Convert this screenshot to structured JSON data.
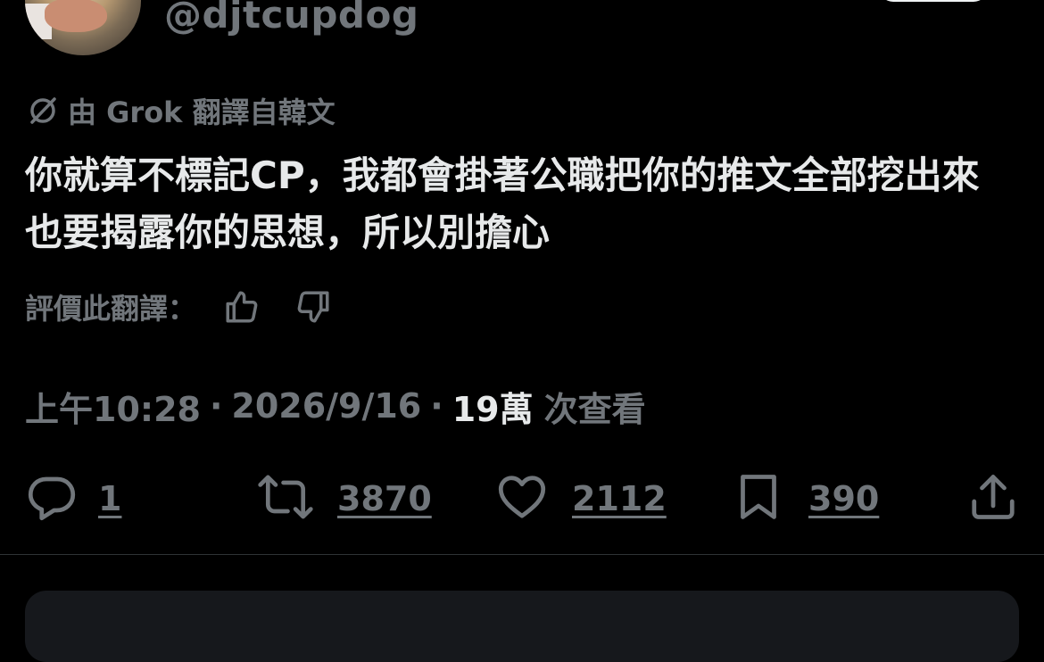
{
  "tweet": {
    "handle": "@djtcupdog",
    "translation_note": "由 Grok 翻譯自韓文",
    "text": "你就算不標記CP，我都會掛著公職把你的推文全部挖出來也要揭露你的思想，所以別擔心",
    "rate_label": "評價此翻譯：",
    "time": "上午10:28",
    "date": "2026/9/16",
    "views_count": "19萬",
    "views_label": "次查看",
    "separator": "·"
  },
  "actions": {
    "reply_count": "1",
    "retweet_count": "3870",
    "like_count": "2112",
    "bookmark_count": "390"
  },
  "icons": {
    "grok": "grok-icon",
    "thumbs_up": "thumbs-up-icon",
    "thumbs_down": "thumbs-down-icon",
    "reply": "reply-icon",
    "retweet": "retweet-icon",
    "like": "heart-icon",
    "bookmark": "bookmark-icon",
    "share": "share-icon"
  },
  "colors": {
    "background": "#000000",
    "text_primary": "#e7e9ea",
    "text_secondary": "#71767b",
    "divider": "#2f3336"
  }
}
